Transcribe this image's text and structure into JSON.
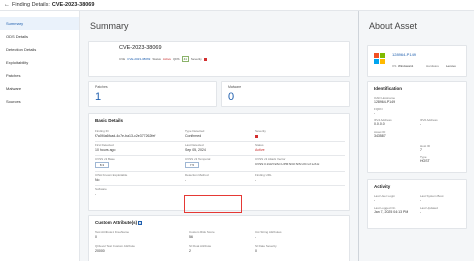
{
  "topbar": {
    "back_icon": "arrow-left-icon",
    "crumb": "Finding Details:",
    "cve": "CVE-2023-38069"
  },
  "nav": {
    "items": [
      "Summary",
      "ODS Details",
      "Detection Details",
      "Exploitability",
      "Patches",
      "Malware",
      "Sources"
    ],
    "active_index": 0
  },
  "summary": {
    "title": "Summary",
    "cve_title": "CVE-2023-38069",
    "meta": {
      "cve_lbl": "CVE",
      "cve_val": "CVE-2023-38069",
      "status_lbl": "Status",
      "status_val": "Active",
      "qds_lbl": "QDS",
      "qds_val": "41",
      "severity_lbl": "Severity"
    },
    "patches": {
      "label": "Patches",
      "value": "1"
    },
    "malware": {
      "label": "Malware",
      "value": "0"
    }
  },
  "basic": {
    "title": "Basic Details",
    "rows": [
      {
        "col1": [
          "Finding ID",
          "f7a0f4a6fcad-4c7e-ba13-c2e377262fef"
        ],
        "col2": [
          "Type Detected",
          "Confirmed"
        ],
        "col3": [
          "Severity",
          ""
        ]
      },
      {
        "col1": [
          "First Detected",
          "10 hours ago"
        ],
        "col2": [
          "Last Detected",
          "Sep 05, 2024"
        ],
        "col3": [
          "Status",
          "Active"
        ]
      },
      {
        "col1": [
          "CVSS v3 Base",
          "8.3"
        ],
        "col2": [
          "CVSS v3 Temporal",
          "7.5"
        ],
        "col3": [
          "CVSS v3 Attack Vector",
          "CVSS:3.1/AV:N/AC:L/PR:N/UI:N/S:U/C:L/I:L/A:H"
        ]
      },
      {
        "col1": [
          "CISA Known Exploitable",
          "No"
        ],
        "col2": [
          "Detection Method",
          "-"
        ],
        "col3": [
          "Finding URL",
          "-"
        ]
      },
      {
        "col1": [
          "Software",
          "-"
        ],
        "col2": [
          "",
          ""
        ],
        "col3": [
          "",
          ""
        ]
      }
    ]
  },
  "custom": {
    "title": "Custom Attribute(s)",
    "info_icon": "i",
    "fields": [
      {
        "label": "Test Attribute1 FreeName",
        "value": "0"
      },
      {
        "label": "Custom Risk Score",
        "value": "56"
      },
      {
        "label": "Cst String Attributes",
        "value": "-"
      },
      {
        "label": "QClevel Test Custom Attribute",
        "value": "20000"
      },
      {
        "label": "SI Float Attribute",
        "value": "2"
      },
      {
        "label": "SI Date Severity",
        "value": "0"
      }
    ]
  },
  "about": {
    "title": "About Asset",
    "asset_name": "128964-P149",
    "os_lbl": "OS",
    "os_val": "Windows11",
    "hw_lbl": "Hardware",
    "hw_val": "Lenovo",
    "id_title": "Identification",
    "id_rows": [
      [
        "OAD Hostname",
        "128964-P149"
      ],
      [
        "FQDN",
        "-"
      ],
      [
        "IPv4 Address",
        "0.0.0.0"
      ],
      [
        "IPv6 Address",
        "-"
      ],
      [
        "Asset ID",
        "343587"
      ],
      [
        "Host ID",
        "7"
      ],
      [
        "Type",
        "HOST"
      ]
    ],
    "act_title": "Activity",
    "act_rows": [
      [
        "Last User Login",
        "-"
      ],
      [
        "Last System Boot",
        "-"
      ],
      [
        "Last Logged On",
        "Jan 7, 2025 04:13 PM"
      ],
      [
        "Last Updated",
        "-"
      ]
    ],
    "brand_colors": {
      "win_red": "#f25022",
      "win_green": "#7fba00",
      "win_blue": "#00a4ef",
      "win_yellow": "#ffb900"
    }
  },
  "colors": {
    "accent": "#1f5fae",
    "danger": "#d32f2f",
    "highlight": "#e53935"
  }
}
